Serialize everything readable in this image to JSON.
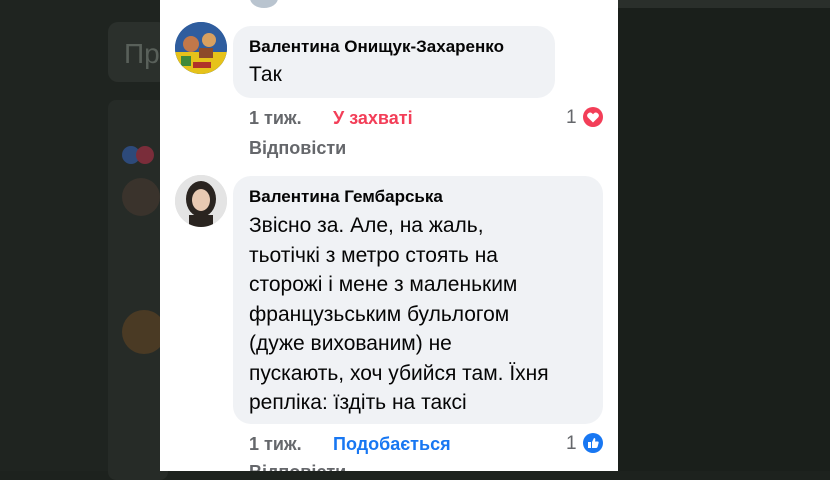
{
  "colors": {
    "love": "#f33e58",
    "like": "#1877f2",
    "bubble": "#f0f2f5",
    "meta": "#65676b"
  },
  "comments": [
    {
      "author": "Валентина Онищук-Захаренко",
      "text": "Так",
      "time": "1 тиж.",
      "reaction_label": "У захваті",
      "reaction_icon": "heart-icon",
      "reaction_count": "1",
      "reply_label": "Відповісти"
    },
    {
      "author": "Валентина Гембарська",
      "text_lines": [
        "Звісно за. Але, на жаль,",
        "тьотічкі з метро стоять на",
        "сторожі і мене з маленьким",
        "французьським бульлогом",
        "(дуже вихованим) не",
        "пускають, хоч убийся там. Їхня",
        "репліка: їздіть на таксі"
      ],
      "time": "1 тиж.",
      "reaction_label": "Подобається",
      "reaction_icon": "thumbs-up-icon",
      "reaction_count": "1",
      "reply_label": "Відповісти"
    }
  ]
}
